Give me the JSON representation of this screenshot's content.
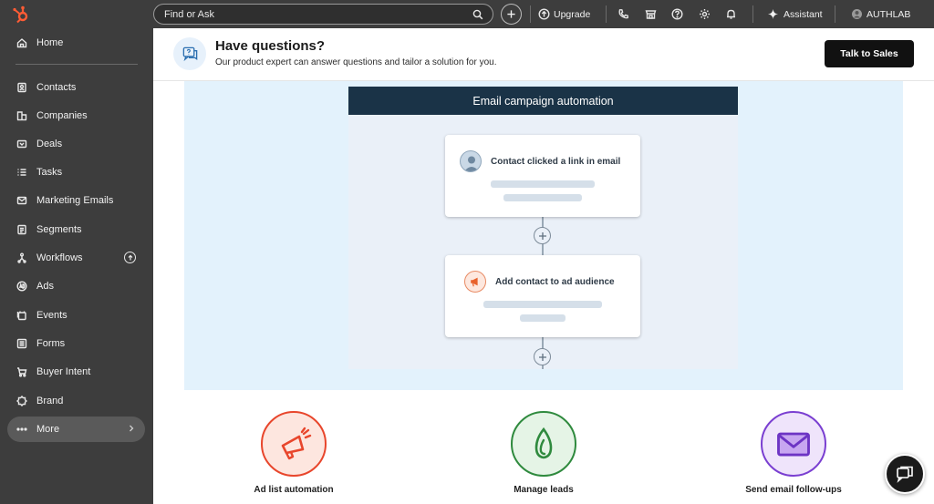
{
  "sidebar": {
    "items": [
      {
        "label": "Home",
        "icon": "home-icon"
      },
      {
        "label": "Contacts",
        "icon": "contacts-icon"
      },
      {
        "label": "Companies",
        "icon": "companies-icon"
      },
      {
        "label": "Deals",
        "icon": "deals-icon"
      },
      {
        "label": "Tasks",
        "icon": "tasks-icon"
      },
      {
        "label": "Marketing Emails",
        "icon": "email-icon"
      },
      {
        "label": "Segments",
        "icon": "segments-icon"
      },
      {
        "label": "Workflows",
        "icon": "workflows-icon"
      },
      {
        "label": "Ads",
        "icon": "ads-icon"
      },
      {
        "label": "Events",
        "icon": "events-icon"
      },
      {
        "label": "Forms",
        "icon": "forms-icon"
      },
      {
        "label": "Buyer Intent",
        "icon": "buyer-intent-icon"
      },
      {
        "label": "Brand",
        "icon": "brand-icon"
      }
    ],
    "more_label": "More"
  },
  "topbar": {
    "search_placeholder": "Find or Ask",
    "upgrade_label": "Upgrade",
    "assistant_label": "Assistant",
    "account_label": "AUTHLAB"
  },
  "banner": {
    "title": "Have questions?",
    "subtitle": "Our product expert can answer questions and tailor a solution for you.",
    "cta_label": "Talk to Sales"
  },
  "workflow": {
    "header": "Email campaign automation",
    "cards": [
      {
        "title": "Contact clicked a link in email"
      },
      {
        "title": "Add contact to ad audience"
      }
    ]
  },
  "features": [
    {
      "label": "Ad list automation",
      "color": "#e8462c"
    },
    {
      "label": "Manage leads",
      "color": "#2f8a3e"
    },
    {
      "label": "Send email follow-ups",
      "color": "#7a3fd1"
    }
  ],
  "colors": {
    "sidebar_bg": "#3d3d3d",
    "accent_orange": "#ff5c35",
    "panel_bg": "#e3f2fc",
    "workflow_header": "#1a3347"
  }
}
